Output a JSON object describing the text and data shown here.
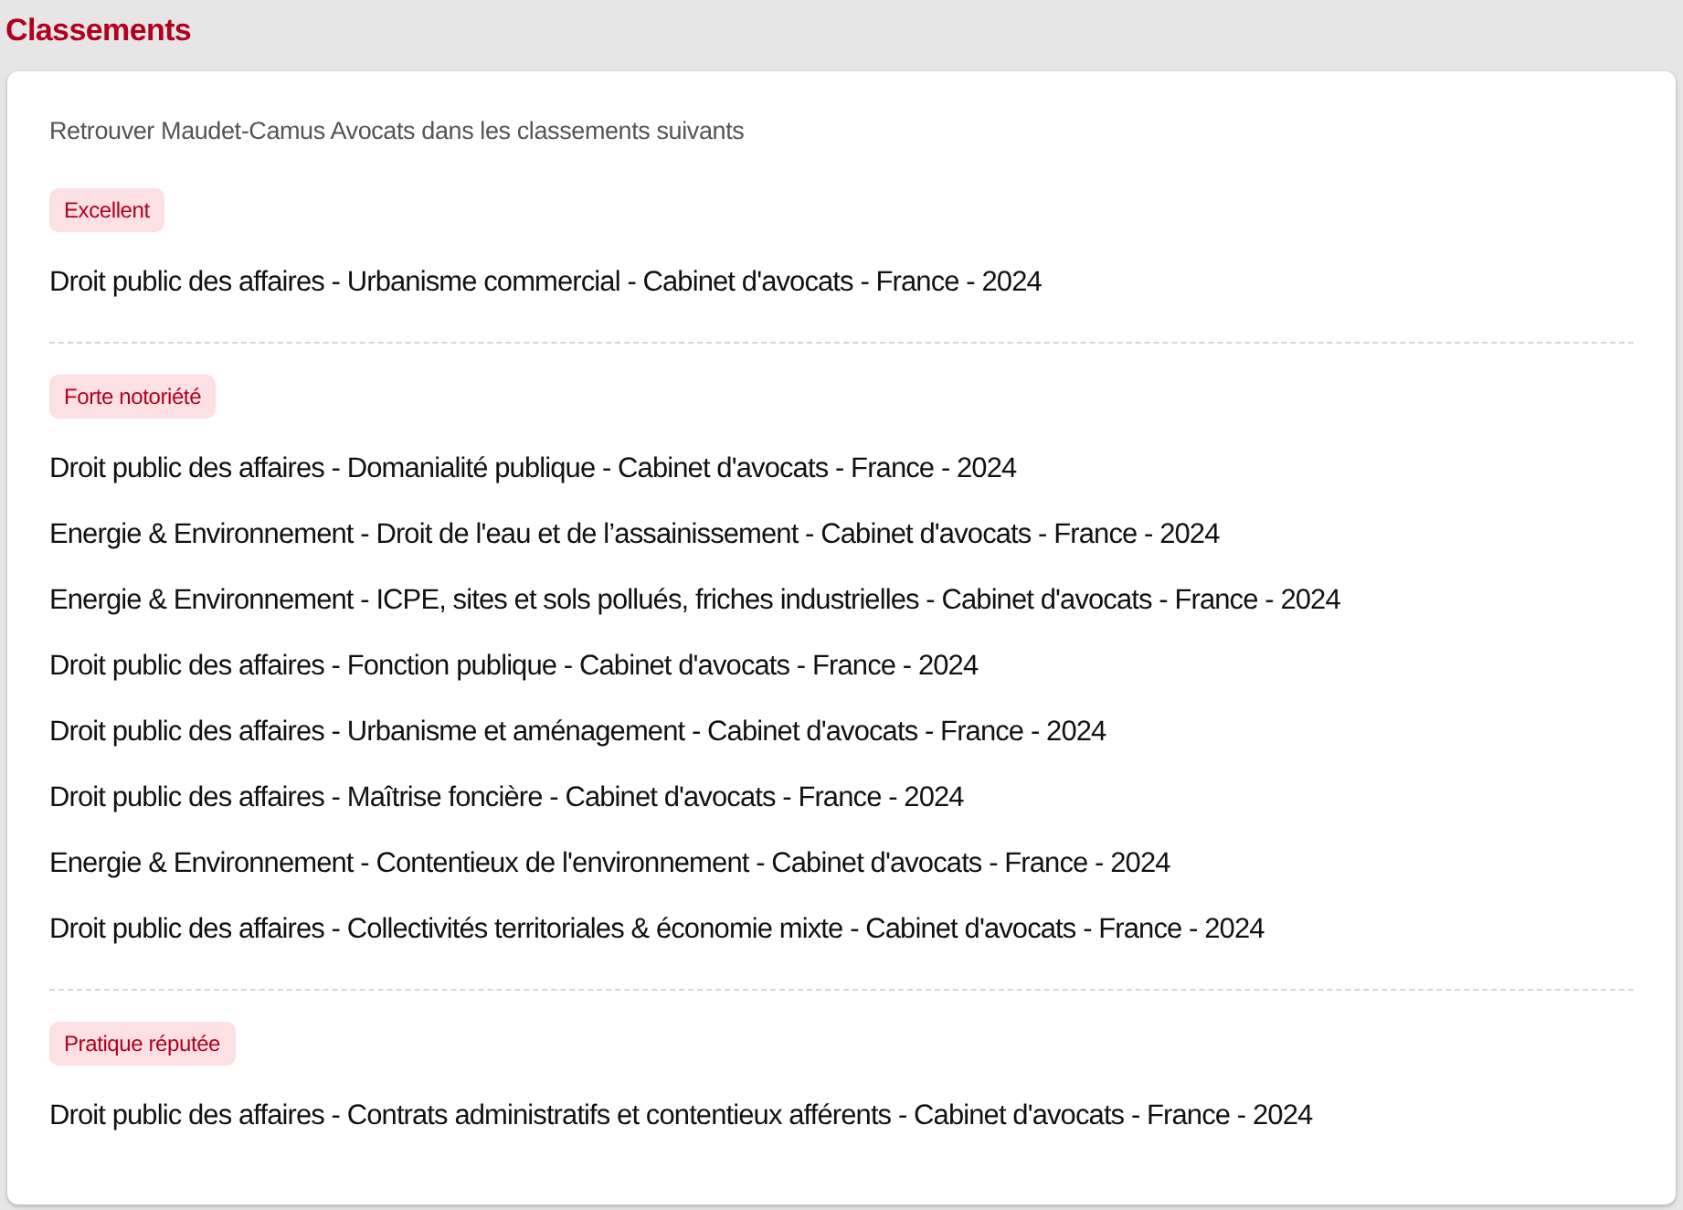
{
  "title": "Classements",
  "intro": "Retrouver Maudet-Camus Avocats dans les classements suivants",
  "groups": [
    {
      "badge": "Excellent",
      "items": [
        "Droit public des affaires - Urbanisme commercial - Cabinet d'avocats - France - 2024"
      ]
    },
    {
      "badge": "Forte notoriété",
      "items": [
        "Droit public des affaires - Domanialité publique - Cabinet d'avocats - France - 2024",
        "Energie & Environnement - Droit de l'eau et de l’assainissement - Cabinet d'avocats - France - 2024",
        "Energie & Environnement - ICPE, sites et sols pollués, friches industrielles - Cabinet d'avocats - France - 2024",
        "Droit public des affaires - Fonction publique - Cabinet d'avocats - France - 2024",
        "Droit public des affaires - Urbanisme et aménagement - Cabinet d'avocats - France - 2024",
        "Droit public des affaires - Maîtrise foncière - Cabinet d'avocats - France - 2024",
        "Energie & Environnement - Contentieux de l'environnement - Cabinet d'avocats - France - 2024",
        "Droit public des affaires - Collectivités territoriales & économie mixte - Cabinet d'avocats - France - 2024"
      ]
    },
    {
      "badge": "Pratique réputée",
      "items": [
        "Droit public des affaires - Contrats administratifs et contentieux afférents - Cabinet d'avocats - France - 2024"
      ]
    }
  ]
}
